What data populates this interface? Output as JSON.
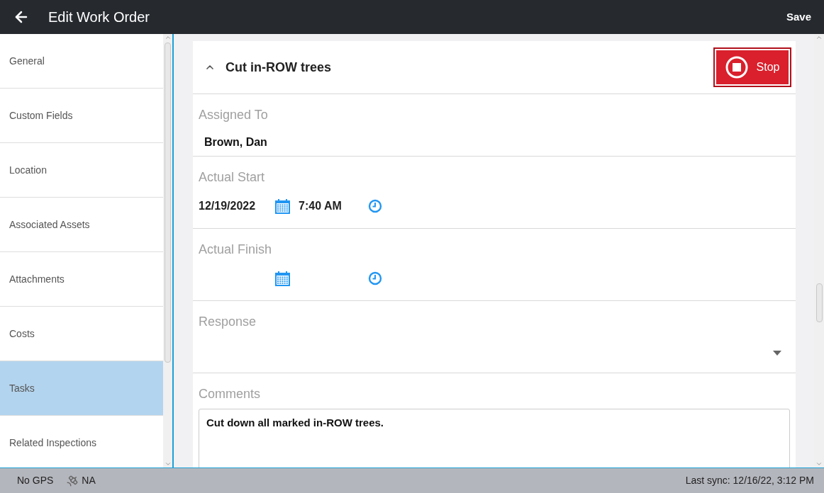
{
  "header": {
    "title": "Edit Work Order",
    "save": "Save"
  },
  "sidebar": {
    "items": [
      {
        "label": "General",
        "selected": false
      },
      {
        "label": "Custom Fields",
        "selected": false
      },
      {
        "label": "Location",
        "selected": false
      },
      {
        "label": "Associated Assets",
        "selected": false
      },
      {
        "label": "Attachments",
        "selected": false
      },
      {
        "label": "Costs",
        "selected": false
      },
      {
        "label": "Tasks",
        "selected": true
      },
      {
        "label": "Related Inspections",
        "selected": false
      }
    ]
  },
  "task": {
    "title": "Cut in-ROW trees",
    "expanded": true,
    "stop_button": "Stop",
    "fields": [
      {
        "kind": "text",
        "label": "Assigned To",
        "value": "Brown, Dan"
      },
      {
        "kind": "datetime",
        "label": "Actual Start",
        "date": "12/19/2022",
        "time": "7:40 AM"
      },
      {
        "kind": "datetime",
        "label": "Actual Finish"
      },
      {
        "kind": "dropdown",
        "label": "Response"
      },
      {
        "kind": "textarea",
        "label": "Comments",
        "value": "Cut down all marked in-ROW trees."
      }
    ]
  },
  "status_bar": {
    "gps": "No GPS",
    "satellite": "NA",
    "last_sync": "Last sync: 12/16/22, 3:12 PM"
  }
}
